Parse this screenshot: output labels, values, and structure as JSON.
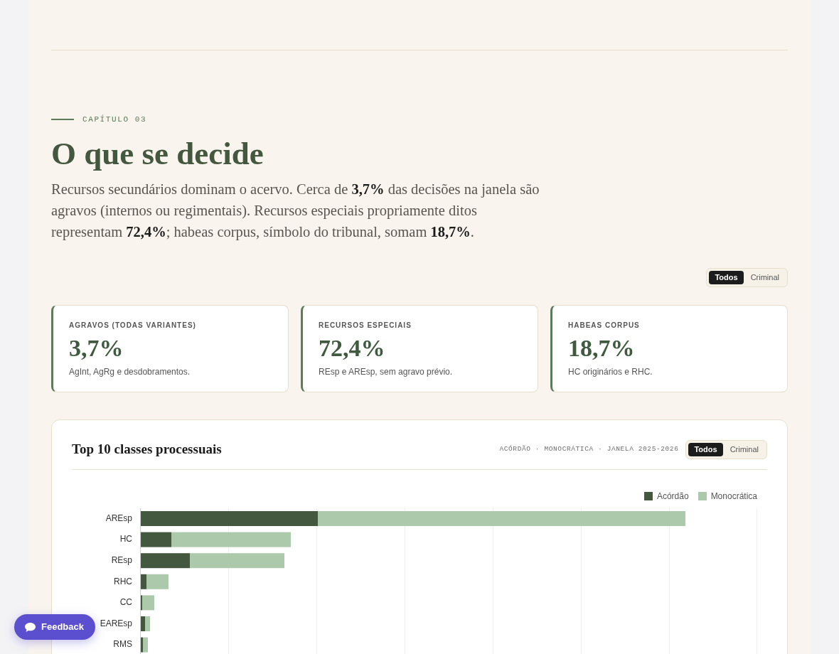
{
  "header": {
    "chapter": "CAPÍTULO 03",
    "title": "O que se decide",
    "lead": "Recursos secundários dominam o acervo. Cerca de **3,7%** das decisões na janela são agravos (internos ou regimentais). Recursos especiais propriamente ditos representam **72,4%**; habeas corpus, símbolo do tribunal, somam **18,7%**."
  },
  "filter": [
    {
      "label": "Todos",
      "selected": true
    },
    {
      "label": "Criminal",
      "selected": false
    }
  ],
  "stats": [
    {
      "label": "AGRAVOS (TODAS VARIANTES)",
      "value": "3,7%",
      "note": "AgInt, AgRg e desdobramentos."
    },
    {
      "label": "RECURSOS ESPECIAIS",
      "value": "72,4%",
      "note": "REsp e AREsp, sem agravo prévio."
    },
    {
      "label": "HABEAS CORPUS",
      "value": "18,7%",
      "note": "HC originários e RHC."
    }
  ],
  "chart_panel": {
    "title": "Top 10 classes processuais",
    "meta": "ACÓRDÃO · MONOCRÁTICA · JANELA 2025-2026",
    "filter": [
      {
        "label": "Todos",
        "selected": true
      },
      {
        "label": "Criminal",
        "selected": false
      }
    ],
    "legend": [
      {
        "label": "Acórdão",
        "color": "#44573f"
      },
      {
        "label": "Monocrática",
        "color": "#adc9ab"
      }
    ],
    "rows": [
      {
        "label": "AREsp"
      },
      {
        "label": "HC"
      },
      {
        "label": "REsp"
      },
      {
        "label": "RHC"
      },
      {
        "label": "CC"
      },
      {
        "label": "EAREsp"
      },
      {
        "label": "RMS"
      }
    ]
  },
  "feedback_button": {
    "label": "Feedback"
  }
}
